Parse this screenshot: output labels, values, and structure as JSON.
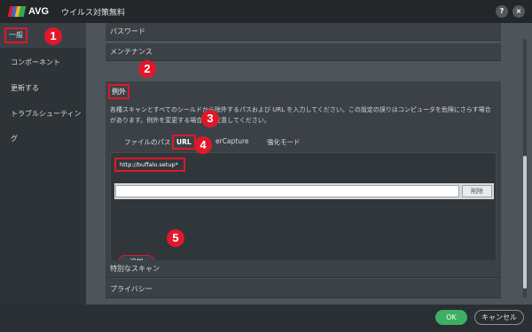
{
  "titlebar": {
    "logo_text": "AVG",
    "title": "ウイルス対策無料",
    "help_icon": "?",
    "close_icon": "×"
  },
  "colors": {
    "logo_red": "#e0182a",
    "logo_blue": "#2a6fcf",
    "logo_yellow": "#f2b51c",
    "logo_green": "#33a852",
    "accent_green": "#3fae63",
    "highlight_red": "#e0182a"
  },
  "sidebar": {
    "items": [
      {
        "label": "一般"
      },
      {
        "label": "コンポーネント"
      },
      {
        "label": "更新する"
      },
      {
        "label": "トラブルシューティング"
      }
    ]
  },
  "main": {
    "rows_top": [
      {
        "label": "パスワード"
      },
      {
        "label": "メンテナンス"
      }
    ],
    "exceptions": {
      "title": "例外",
      "description": "各種スキャンとすべてのシールドから除外するパスおよび URL を入力してください。この設定の誤りはコンピュータを危険にさらす場合があります。例外を変更する場合には注意してください。",
      "tabs": [
        {
          "label": "ファイルのパス"
        },
        {
          "label": "URL"
        },
        {
          "label": "erCapture"
        },
        {
          "label": "強化モード"
        }
      ],
      "url_item": "http://buffalo.setup*",
      "input_value": "",
      "delete_label": "削除",
      "add_label": "追加"
    },
    "rows_bottom": [
      {
        "label": "特別なスキャン"
      },
      {
        "label": "プライバシー"
      }
    ]
  },
  "badges": {
    "b1": "1",
    "b2": "2",
    "b3": "3",
    "b4": "4",
    "b5": "5"
  },
  "footer": {
    "ok_label": "OK",
    "cancel_label": "キャンセル"
  }
}
